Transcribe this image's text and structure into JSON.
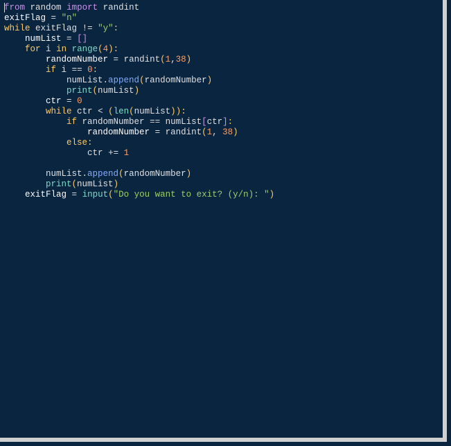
{
  "code": {
    "l1": {
      "from": "from",
      "random_mod": "random",
      "import": "import",
      "randint": "randint"
    },
    "l2": {
      "exitFlag": "exitFlag",
      "eq": "=",
      "n_str": "\"n\""
    },
    "l3": {
      "while": "while",
      "exitFlag": "exitFlag",
      "neq": "!=",
      "y_str": "\"y\"",
      "colon": ":"
    },
    "l4": {
      "numList": "numList",
      "eq": "=",
      "lb": "[",
      "rb": "]"
    },
    "l5": {
      "for": "for",
      "i": "i",
      "in": "in",
      "range": "range",
      "lp": "(",
      "four": "4",
      "rp": ")",
      "colon": ":"
    },
    "l6": {
      "randomNumber": "randomNumber",
      "eq": "=",
      "randint": "randint",
      "lp": "(",
      "one": "1",
      "comma": ",",
      "thirtyeight": "38",
      "rp": ")"
    },
    "l7": {
      "if": "if",
      "i": "i",
      "eqeq": "==",
      "zero": "0",
      "colon": ":"
    },
    "l8": {
      "numList": "numList",
      "dot": ".",
      "append": "append",
      "lp": "(",
      "randomNumber": "randomNumber",
      "rp": ")"
    },
    "l9": {
      "print": "print",
      "lp": "(",
      "numList": "numList",
      "rp": ")"
    },
    "l10": {
      "ctr": "ctr",
      "eq": "=",
      "zero": "0"
    },
    "l11": {
      "while": "while",
      "ctr": "ctr",
      "lt": "<",
      "lp": "(",
      "len": "len",
      "lp2": "(",
      "numList": "numList",
      "rp2": ")",
      "rp": ")",
      "colon": ":"
    },
    "l12": {
      "if": "if",
      "randomNumber": "randomNumber",
      "eqeq": "==",
      "numList": "numList",
      "lb": "[",
      "ctr": "ctr",
      "rb": "]",
      "colon": ":"
    },
    "l13": {
      "randomNumber": "randomNumber",
      "eq": "=",
      "randint": "randint",
      "lp": "(",
      "one": "1",
      "comma": ", ",
      "thirtyeight": "38",
      "rp": ")"
    },
    "l14": {
      "else": "else",
      "colon": ":"
    },
    "l15": {
      "ctr": "ctr",
      "pluseq": "+=",
      "one": "1"
    },
    "l16": {
      "numList": "numList",
      "dot": ".",
      "append": "append",
      "lp": "(",
      "randomNumber": "randomNumber",
      "rp": ")"
    },
    "l17": {
      "print": "print",
      "lp": "(",
      "numList": "numList",
      "rp": ")"
    },
    "l18": {
      "exitFlag": "exitFlag",
      "eq": "=",
      "input": "input",
      "lp": "(",
      "prompt": "\"Do you want to exit? (y/n): \"",
      "rp": ")"
    }
  },
  "indent": {
    "i1": "    ",
    "i2": "        ",
    "i3": "            ",
    "i4": "                "
  }
}
